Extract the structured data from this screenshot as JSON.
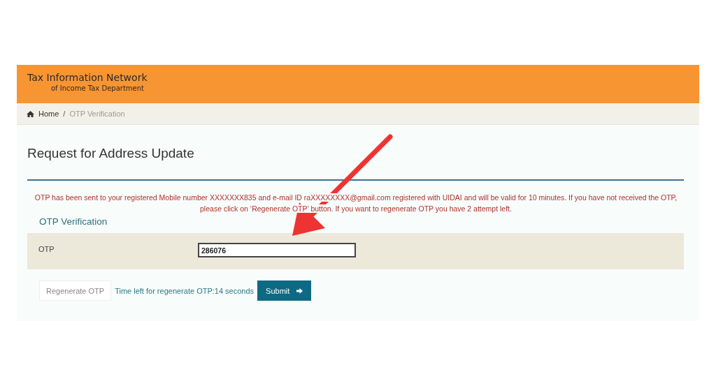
{
  "header": {
    "title": "Tax Information Network",
    "subtitle": "of Income Tax Department"
  },
  "breadcrumb_separator": "/",
  "breadcrumb": [
    {
      "label": "Home",
      "kind": "home"
    },
    {
      "label": "OTP Verification",
      "kind": "current"
    }
  ],
  "page_title": "Request for Address Update",
  "message": "OTP has been sent to your registered Mobile number XXXXXXX835 and e-mail ID raXXXXXXXX@gmail.com registered with UIDAI and will be valid for 10 minutes. If you have not received the OTP, please click on ‘Regenerate OTP’ button. If you want to regenerate OTP you have 2 attempt left.",
  "section_title": "OTP Verification",
  "otp_field": {
    "label": "OTP",
    "value": "286076"
  },
  "regenerate_button": {
    "label": "Regenerate OTP",
    "disabled": true
  },
  "timer": "Time left for regenerate OTP:14 seconds",
  "submit_button": {
    "label": "Submit"
  }
}
